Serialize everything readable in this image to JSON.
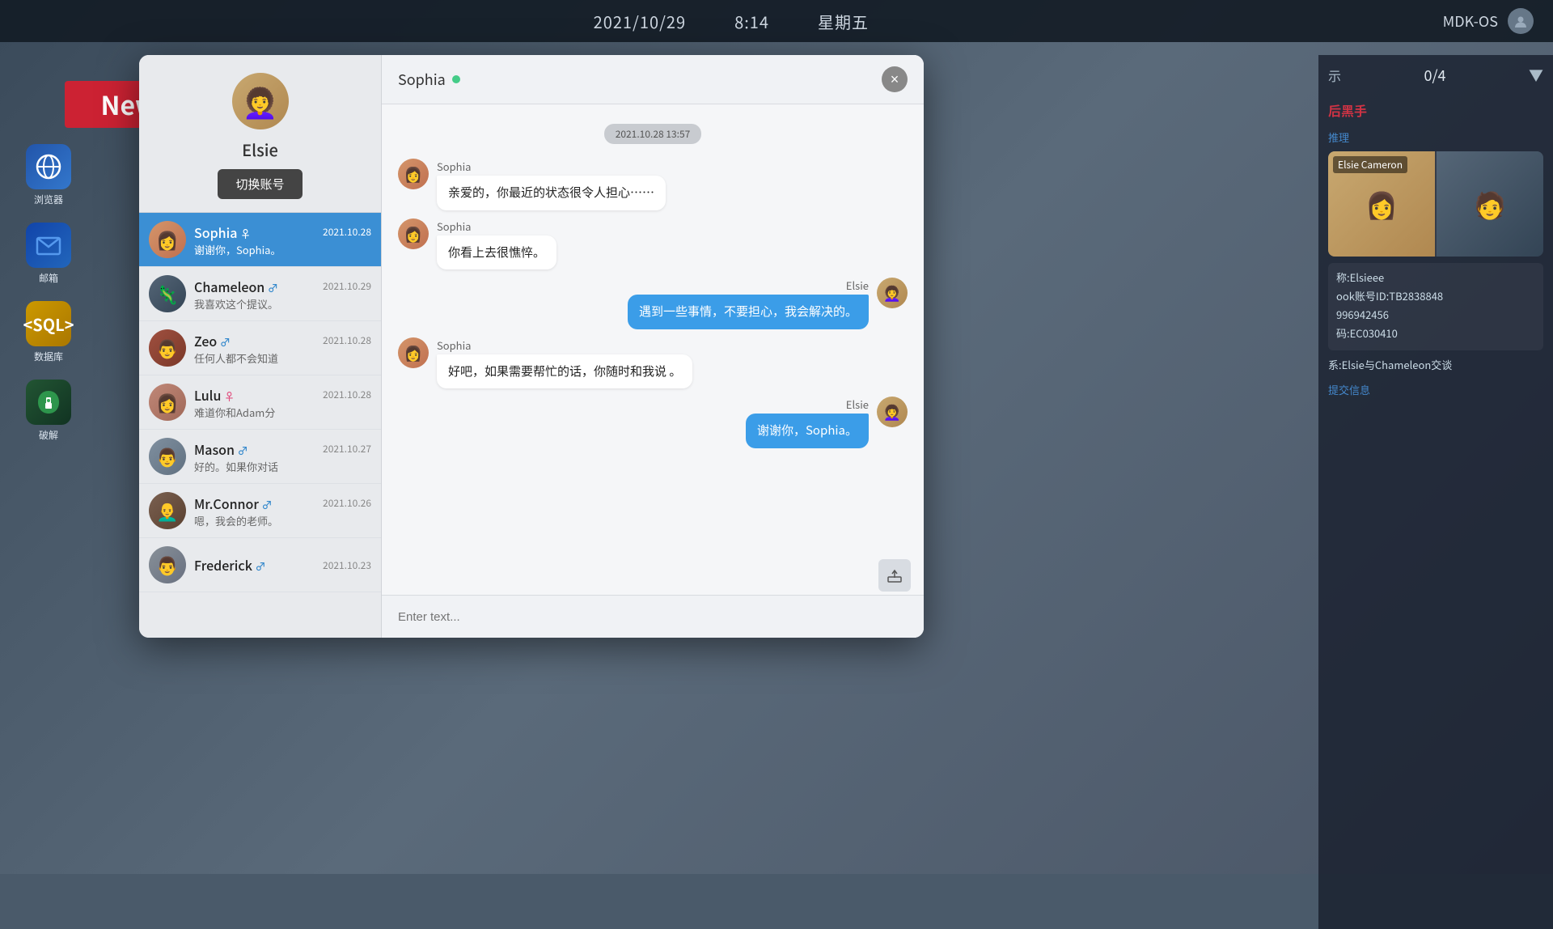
{
  "topbar": {
    "date": "2021/10/29",
    "time": "8:14",
    "weekday": "星期五",
    "system": "MDK-OS"
  },
  "desktop": {
    "browser_label": "浏览器",
    "mail_label": "邮箱",
    "db_label": "数据库",
    "crack_label": "破解"
  },
  "news_banner": {
    "label": "News"
  },
  "right_panel": {
    "show_label": "示",
    "score": "0/4",
    "culprit_title": "后黑手",
    "reasoning_label": "推理",
    "char_name": "Elsie Cameron",
    "nickname_label": "称:Elsieee",
    "facebook_label": "ook账号ID:TB2838848",
    "phone_label": "996942456",
    "code_label": "码:EC030410",
    "relation_label": "系:Elsie与Chameleon交谈",
    "submit_label": "提交信息"
  },
  "chat": {
    "user": {
      "name": "Elsie",
      "switch_btn": "切换账号"
    },
    "close_btn": "×",
    "active_contact": {
      "name": "Sophia",
      "gender": "♀",
      "online": true
    },
    "contacts": [
      {
        "id": "sophia",
        "name": "Sophia",
        "gender": "♀",
        "gender_type": "female",
        "date": "2021.10.28",
        "preview": "谢谢你，Sophia。",
        "active": true
      },
      {
        "id": "chameleon",
        "name": "Chameleon",
        "gender": "♂",
        "gender_type": "male",
        "date": "2021.10.29",
        "preview": "我喜欢这个提议。",
        "active": false
      },
      {
        "id": "zeo",
        "name": "Zeo",
        "gender": "♂",
        "gender_type": "male",
        "date": "2021.10.28",
        "preview": "任何人都不会知道",
        "active": false
      },
      {
        "id": "lulu",
        "name": "Lulu",
        "gender": "♀",
        "gender_type": "female",
        "date": "2021.10.28",
        "preview": "难道你和Adam分",
        "active": false
      },
      {
        "id": "mason",
        "name": "Mason",
        "gender": "♂",
        "gender_type": "male",
        "date": "2021.10.27",
        "preview": "好的。如果你对话",
        "active": false
      },
      {
        "id": "mrconnor",
        "name": "Mr.Connor",
        "gender": "♂",
        "gender_type": "male",
        "date": "2021.10.26",
        "preview": "嗯，我会的老师。",
        "active": false
      },
      {
        "id": "frederick",
        "name": "Frederick",
        "gender": "♂",
        "gender_type": "male",
        "date": "2021.10.23",
        "preview": "",
        "active": false
      }
    ],
    "timestamp": "2021.10.28  13:57",
    "messages": [
      {
        "id": "m1",
        "sender": "Sophia",
        "direction": "incoming",
        "text": "亲爱的，你最近的状态很令人担心……"
      },
      {
        "id": "m2",
        "sender": "Sophia",
        "direction": "incoming",
        "text": "你看上去很憔悴。"
      },
      {
        "id": "m3",
        "sender": "Elsie",
        "direction": "outgoing",
        "text": "遇到一些事情，不要担心，我会解决的。"
      },
      {
        "id": "m4",
        "sender": "Sophia",
        "direction": "incoming",
        "text": "好吧，如果需要帮忙的话，你随时和我说\n。"
      },
      {
        "id": "m5",
        "sender": "Elsie",
        "direction": "outgoing",
        "text": "谢谢你，Sophia。"
      }
    ],
    "input_placeholder": "Enter text..."
  }
}
